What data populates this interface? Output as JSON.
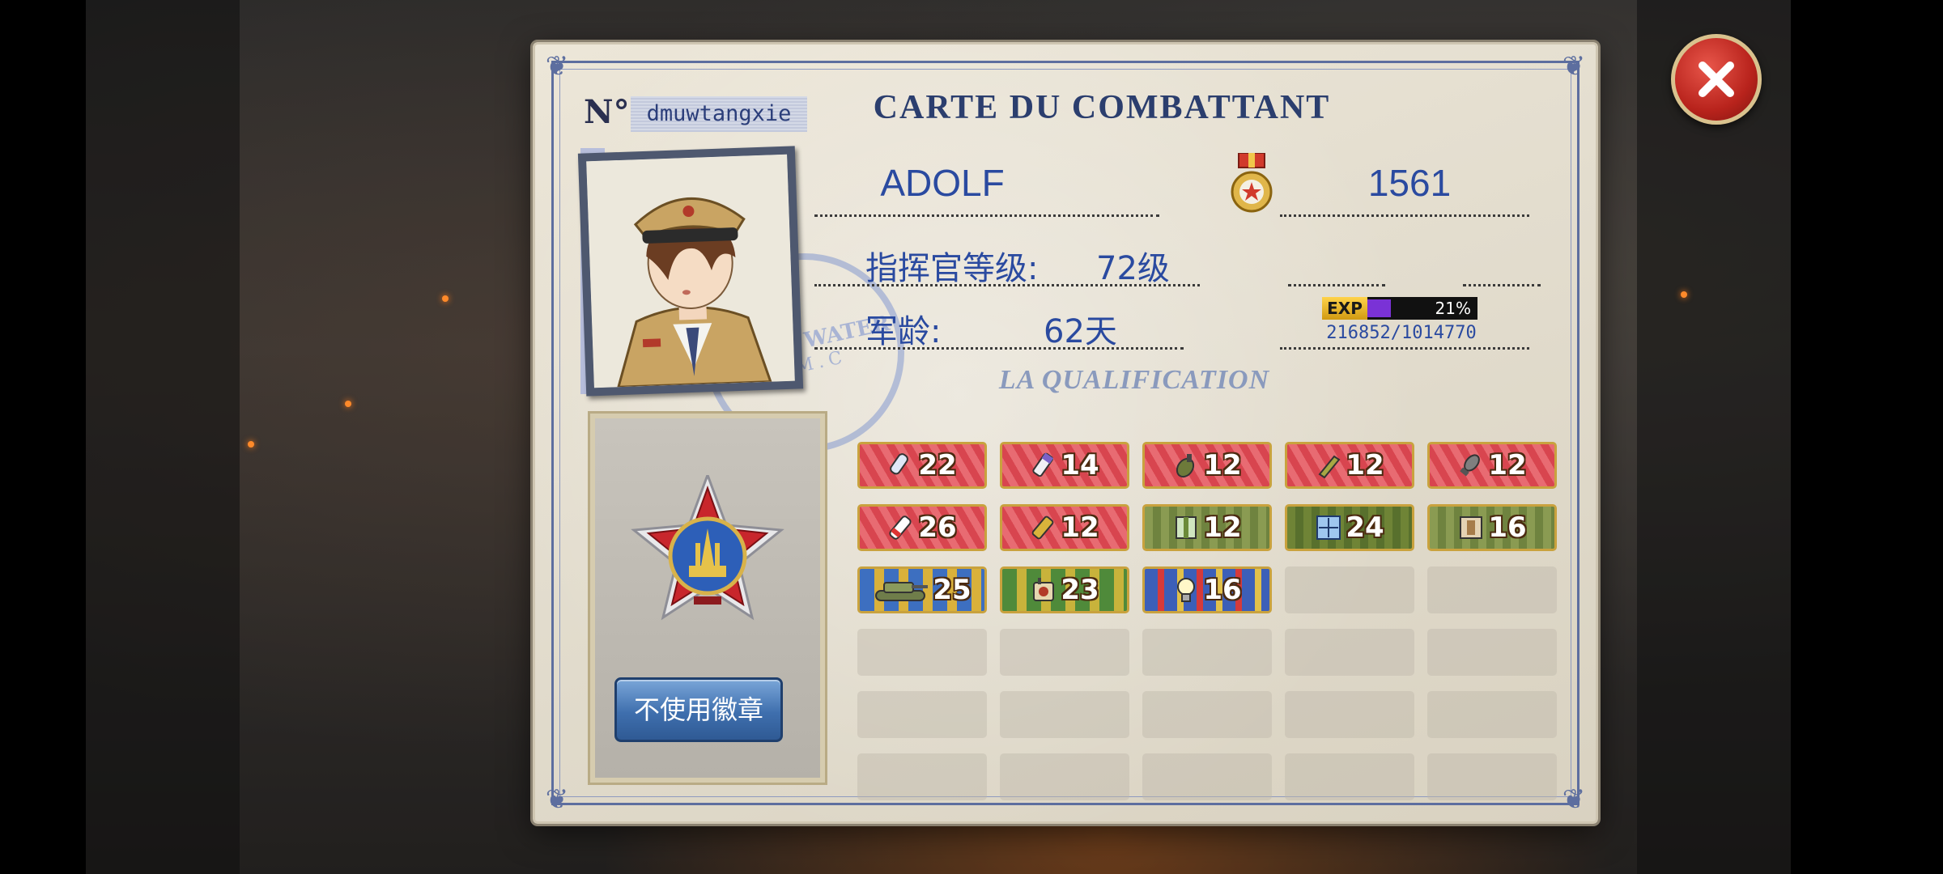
{
  "card": {
    "title": "CARTE DU COMBATTANT",
    "number_label": "N°",
    "player_id": "dmuwtangxie",
    "name": "ADOLF",
    "score": "1561",
    "commander_level_label": "指挥官等级:",
    "commander_level_value": "72级",
    "service_label": "军龄:",
    "service_value": "62天",
    "exp_label": "EXP",
    "exp_percent": "21%",
    "exp_fraction": 0.21,
    "exp_numbers": "216852/1014770",
    "qualification_title": "LA QUALIFICATION",
    "stamp_text": "BLACK WATER",
    "stamp_sub": "A.M.C",
    "badge_button": "不使用徽章"
  },
  "qualifications": [
    {
      "icon": "bullet-icon",
      "value": "22",
      "style": "red"
    },
    {
      "icon": "shell-icon",
      "value": "14",
      "style": "red"
    },
    {
      "icon": "grenade-icon",
      "value": "12",
      "style": "red"
    },
    {
      "icon": "rocket-icon",
      "value": "12",
      "style": "red"
    },
    {
      "icon": "mortar-icon",
      "value": "12",
      "style": "red"
    },
    {
      "icon": "cartridge-icon",
      "value": "26",
      "style": "red"
    },
    {
      "icon": "ammo-icon",
      "value": "12",
      "style": "red"
    },
    {
      "icon": "armor-plate-icon",
      "value": "12",
      "style": "green"
    },
    {
      "icon": "scope-icon",
      "value": "24",
      "style": "darkgreen"
    },
    {
      "icon": "crate-icon",
      "value": "16",
      "style": "green"
    },
    {
      "icon": "tank-icon",
      "value": "25",
      "style": "tank"
    },
    {
      "icon": "radio-icon",
      "value": "23",
      "style": "olive"
    },
    {
      "icon": "bulb-icon",
      "value": "16",
      "style": "stripe"
    }
  ],
  "colors": {
    "accent_blue": "#2a4aa0",
    "frame_blue": "#5d6e9f",
    "close_red": "#b8231c",
    "exp_purple": "#7a32d6"
  }
}
